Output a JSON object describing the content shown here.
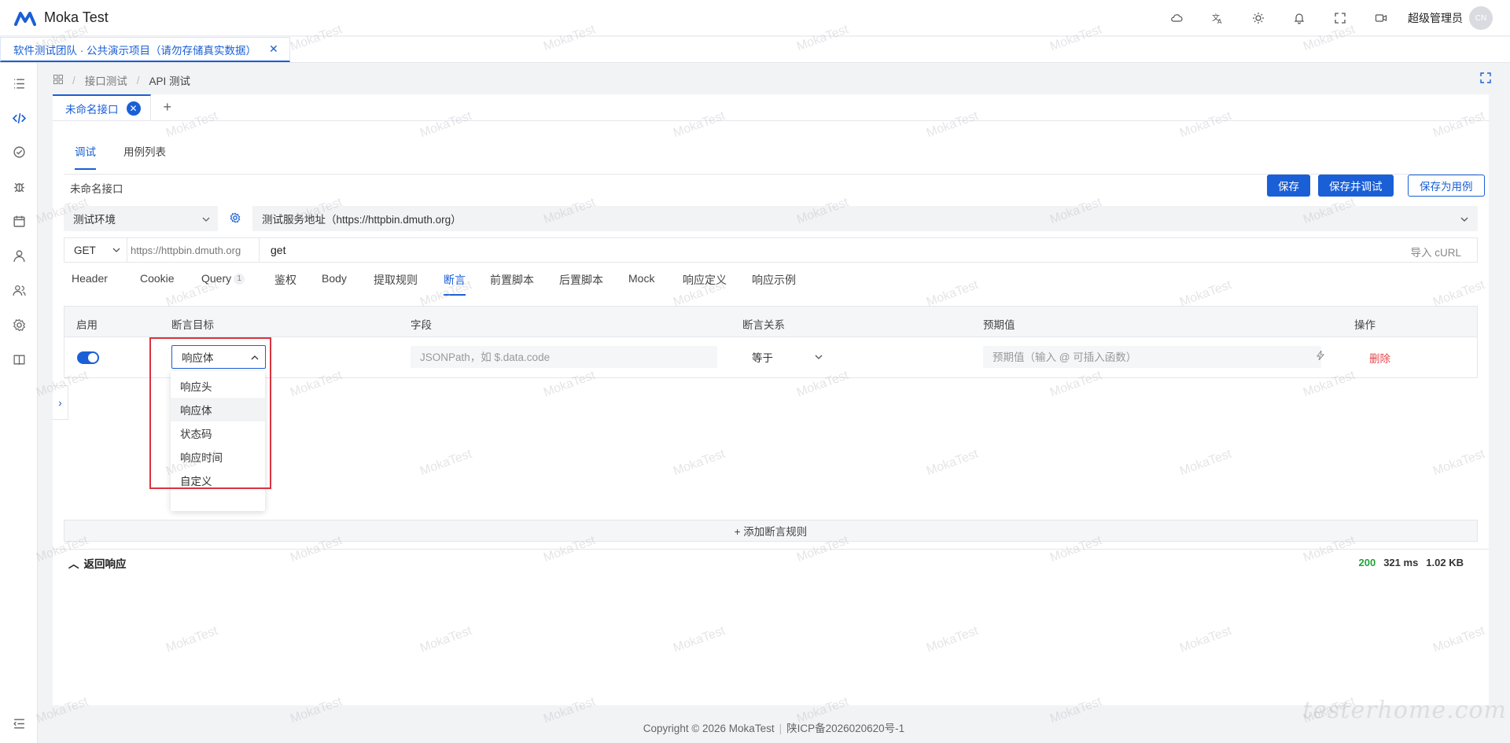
{
  "app": {
    "title": "Moka Test",
    "user_name": "超级管理员",
    "avatar_text": "CN"
  },
  "header_icons": [
    "cloud-icon",
    "translate-icon",
    "theme-icon",
    "bell-icon",
    "fullscreen-icon",
    "video-icon"
  ],
  "workspace_tab": {
    "label": "软件测试团队 · 公共演示项目（请勿存储真实数据）"
  },
  "breadcrumb": {
    "home_icon": "grid-icon",
    "items": [
      "接口测试",
      "API 测试"
    ]
  },
  "file_tab": {
    "label": "未命名接口",
    "add": "+"
  },
  "sub_tabs": [
    "调试",
    "用例列表"
  ],
  "interface_name": "未命名接口",
  "buttons": {
    "save": "保存",
    "save_debug": "保存并调试",
    "save_case": "保存为用例"
  },
  "env": {
    "selected": "测试环境",
    "server": "测试服务地址（https://httpbin.dmuth.org）"
  },
  "request": {
    "method": "GET",
    "base_url": "https://httpbin.dmuth.org",
    "path": "get",
    "import_curl": "导入 cURL"
  },
  "request_tabs": [
    {
      "label": "Header"
    },
    {
      "label": "Cookie"
    },
    {
      "label": "Query",
      "badge": "1"
    },
    {
      "label": "鉴权"
    },
    {
      "label": "Body"
    },
    {
      "label": "提取规则"
    },
    {
      "label": "断言"
    },
    {
      "label": "前置脚本"
    },
    {
      "label": "后置脚本"
    },
    {
      "label": "Mock"
    },
    {
      "label": "响应定义"
    },
    {
      "label": "响应示例"
    }
  ],
  "assertion_table": {
    "headers": {
      "enabled": "启用",
      "target": "断言目标",
      "field": "字段",
      "relation": "断言关系",
      "expected": "预期值",
      "action": "操作"
    },
    "row": {
      "target": "响应体",
      "field_placeholder": "JSONPath，如 $.data.code",
      "relation": "等于",
      "expected_placeholder": "预期值（输入 @ 可插入函数）",
      "delete": "删除"
    },
    "dropdown_options": [
      "响应头",
      "响应体",
      "状态码",
      "响应时间",
      "自定义"
    ],
    "add_rule": "+ 添加断言规则"
  },
  "response": {
    "title": "返回响应",
    "status": "200",
    "time": "321 ms",
    "size": "1.02 KB"
  },
  "footer": {
    "copyright": "Copyright © 2026 MokaTest",
    "icp": "陕ICP备2026020620号-1"
  },
  "watermark": {
    "text": "MokaTest",
    "brand": "testerhome.com"
  },
  "colors": {
    "primary": "#1a5fd6",
    "danger": "#e5484d",
    "success": "#22a33a"
  }
}
